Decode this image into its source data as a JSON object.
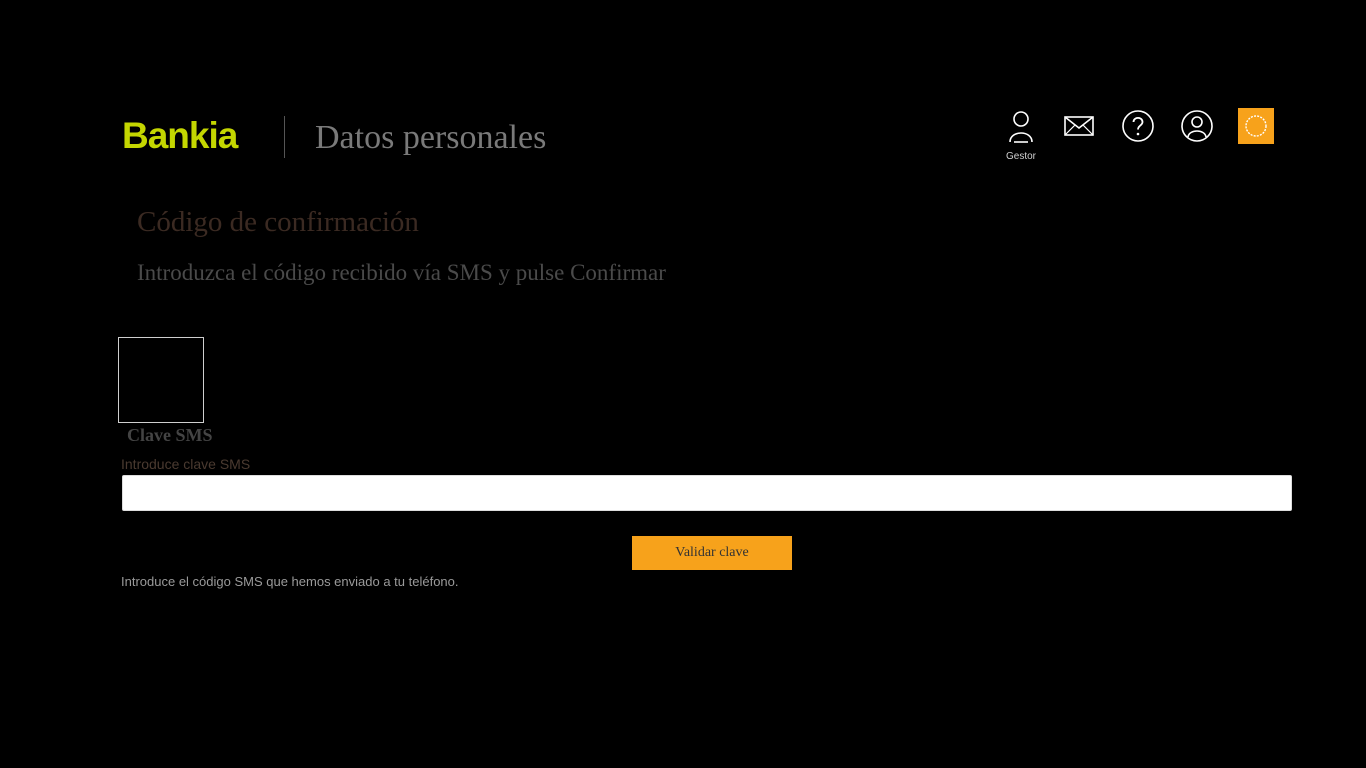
{
  "header": {
    "logo_text": "Bankia",
    "title": "Datos personales",
    "icons": [
      {
        "name": "gestor-icon",
        "label": "Gestor"
      },
      {
        "name": "mail-icon"
      },
      {
        "name": "help-icon"
      },
      {
        "name": "user-profile-icon"
      },
      {
        "name": "power-icon"
      }
    ],
    "colors": {
      "logo": "#c4d600",
      "accent": "#f7a21b"
    }
  },
  "content": {
    "title": "Código de confirmación",
    "subtitle": "Introduzca el código recibido vía SMS y pulse Confirmar",
    "sms_label": "Clave SMS",
    "field_label": "Introduce clave SMS",
    "input_value": "",
    "validate_button": "Validar clave",
    "help_text": "Introduce el código SMS que hemos enviado a tu teléfono."
  }
}
